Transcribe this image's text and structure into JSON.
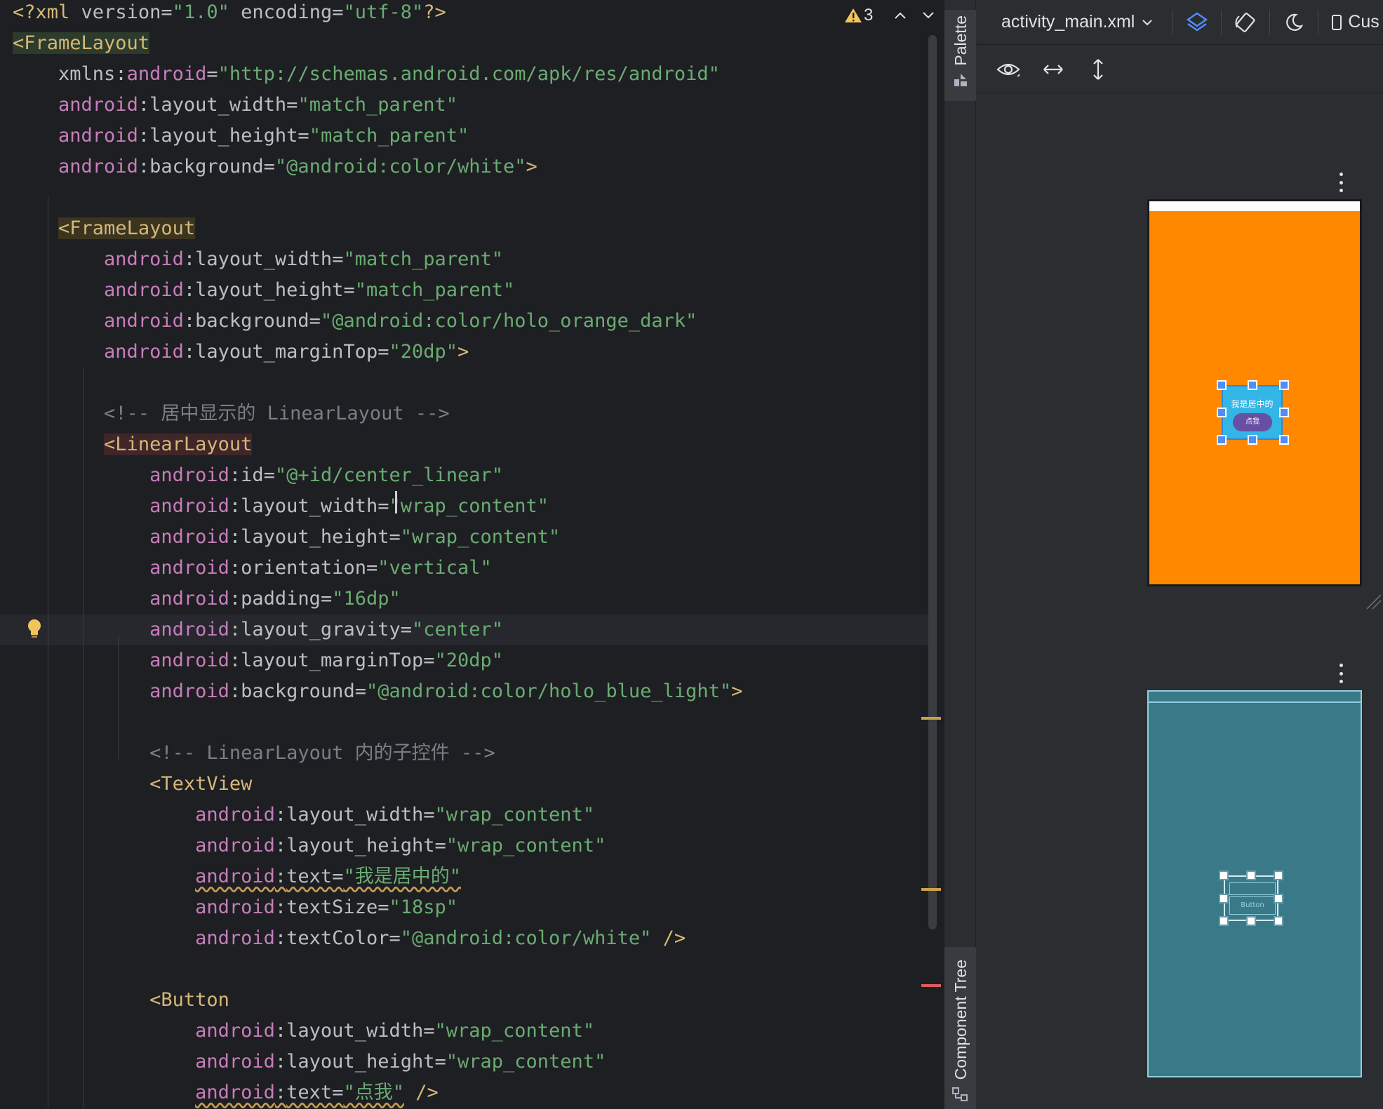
{
  "editor": {
    "lines": [
      [
        {
          "t": "tag",
          "v": "<?xml "
        },
        {
          "t": "attr",
          "v": "version"
        },
        {
          "t": "eq",
          "v": "="
        },
        {
          "t": "str",
          "v": "\"1.0\""
        },
        {
          "t": "plain",
          "v": " "
        },
        {
          "t": "attr",
          "v": "encoding"
        },
        {
          "t": "eq",
          "v": "="
        },
        {
          "t": "str",
          "v": "\"utf-8\""
        },
        {
          "t": "tag",
          "v": "?>"
        }
      ],
      [
        {
          "t": "tag",
          "v": "<FrameLayout",
          "hl": "green"
        }
      ],
      [
        {
          "t": "plain",
          "v": "    "
        },
        {
          "t": "attr",
          "v": "xmlns"
        },
        {
          "t": "eq",
          "v": ":"
        },
        {
          "t": "attrns",
          "v": "android"
        },
        {
          "t": "eq",
          "v": "="
        },
        {
          "t": "str",
          "v": "\"http://schemas.android.com/apk/res/android\""
        }
      ],
      [
        {
          "t": "plain",
          "v": "    "
        },
        {
          "t": "attrns",
          "v": "android"
        },
        {
          "t": "eq",
          "v": ":"
        },
        {
          "t": "attr",
          "v": "layout_width"
        },
        {
          "t": "eq",
          "v": "="
        },
        {
          "t": "str",
          "v": "\"match_parent\""
        }
      ],
      [
        {
          "t": "plain",
          "v": "    "
        },
        {
          "t": "attrns",
          "v": "android"
        },
        {
          "t": "eq",
          "v": ":"
        },
        {
          "t": "attr",
          "v": "layout_height"
        },
        {
          "t": "eq",
          "v": "="
        },
        {
          "t": "str",
          "v": "\"match_parent\""
        }
      ],
      [
        {
          "t": "plain",
          "v": "    "
        },
        {
          "t": "attrns",
          "v": "android"
        },
        {
          "t": "eq",
          "v": ":"
        },
        {
          "t": "attr",
          "v": "background"
        },
        {
          "t": "eq",
          "v": "="
        },
        {
          "t": "str",
          "v": "\"@android:color/white\""
        },
        {
          "t": "tag",
          "v": ">"
        }
      ],
      [],
      [
        {
          "t": "plain",
          "v": "    "
        },
        {
          "t": "tag",
          "v": "<FrameLayout",
          "hl": "olive"
        }
      ],
      [
        {
          "t": "plain",
          "v": "        "
        },
        {
          "t": "attrns",
          "v": "android"
        },
        {
          "t": "eq",
          "v": ":"
        },
        {
          "t": "attr",
          "v": "layout_width"
        },
        {
          "t": "eq",
          "v": "="
        },
        {
          "t": "str",
          "v": "\"match_parent\""
        }
      ],
      [
        {
          "t": "plain",
          "v": "        "
        },
        {
          "t": "attrns",
          "v": "android"
        },
        {
          "t": "eq",
          "v": ":"
        },
        {
          "t": "attr",
          "v": "layout_height"
        },
        {
          "t": "eq",
          "v": "="
        },
        {
          "t": "str",
          "v": "\"match_parent\""
        }
      ],
      [
        {
          "t": "plain",
          "v": "        "
        },
        {
          "t": "attrns",
          "v": "android"
        },
        {
          "t": "eq",
          "v": ":"
        },
        {
          "t": "attr",
          "v": "background"
        },
        {
          "t": "eq",
          "v": "="
        },
        {
          "t": "str",
          "v": "\"@android:color/holo_orange_dark\""
        }
      ],
      [
        {
          "t": "plain",
          "v": "        "
        },
        {
          "t": "attrns",
          "v": "android"
        },
        {
          "t": "eq",
          "v": ":"
        },
        {
          "t": "attr",
          "v": "layout_marginTop"
        },
        {
          "t": "eq",
          "v": "="
        },
        {
          "t": "str",
          "v": "\"20dp\""
        },
        {
          "t": "tag",
          "v": ">"
        }
      ],
      [],
      [
        {
          "t": "plain",
          "v": "        "
        },
        {
          "t": "comment",
          "v": "<!-- 居中显示的 LinearLayout -->"
        }
      ],
      [
        {
          "t": "plain",
          "v": "        "
        },
        {
          "t": "tag",
          "v": "<LinearLayout",
          "hl": "red"
        }
      ],
      [
        {
          "t": "plain",
          "v": "            "
        },
        {
          "t": "attrns",
          "v": "android"
        },
        {
          "t": "eq",
          "v": ":"
        },
        {
          "t": "attr",
          "v": "id"
        },
        {
          "t": "eq",
          "v": "="
        },
        {
          "t": "str",
          "v": "\"@+id/center_linear\""
        }
      ],
      [
        {
          "t": "plain",
          "v": "            "
        },
        {
          "t": "attrns",
          "v": "android"
        },
        {
          "t": "eq",
          "v": ":"
        },
        {
          "t": "attr",
          "v": "layout_width"
        },
        {
          "t": "eq",
          "v": "="
        },
        {
          "t": "str",
          "v": "\"wrap_content\""
        }
      ],
      [
        {
          "t": "plain",
          "v": "            "
        },
        {
          "t": "attrns",
          "v": "android"
        },
        {
          "t": "eq",
          "v": ":"
        },
        {
          "t": "attr",
          "v": "layout_height"
        },
        {
          "t": "eq",
          "v": "="
        },
        {
          "t": "str",
          "v": "\"wrap_content\""
        }
      ],
      [
        {
          "t": "plain",
          "v": "            "
        },
        {
          "t": "attrns",
          "v": "android"
        },
        {
          "t": "eq",
          "v": ":"
        },
        {
          "t": "attr",
          "v": "orientation"
        },
        {
          "t": "eq",
          "v": "="
        },
        {
          "t": "str",
          "v": "\"vertical\""
        }
      ],
      [
        {
          "t": "plain",
          "v": "            "
        },
        {
          "t": "attrns",
          "v": "android"
        },
        {
          "t": "eq",
          "v": ":"
        },
        {
          "t": "attr",
          "v": "padding"
        },
        {
          "t": "eq",
          "v": "="
        },
        {
          "t": "str",
          "v": "\"16dp\""
        }
      ],
      [
        {
          "t": "plain",
          "v": "            "
        },
        {
          "t": "attrns",
          "v": "android"
        },
        {
          "t": "eq",
          "v": ":"
        },
        {
          "t": "attr",
          "v": "layout_gravity"
        },
        {
          "t": "eq",
          "v": "="
        },
        {
          "t": "str",
          "v": "\"center\""
        }
      ],
      [
        {
          "t": "plain",
          "v": "            "
        },
        {
          "t": "attrns",
          "v": "android"
        },
        {
          "t": "eq",
          "v": ":"
        },
        {
          "t": "attr",
          "v": "layout_marginTop"
        },
        {
          "t": "eq",
          "v": "="
        },
        {
          "t": "str",
          "v": "\"20dp\""
        }
      ],
      [
        {
          "t": "plain",
          "v": "            "
        },
        {
          "t": "attrns",
          "v": "android"
        },
        {
          "t": "eq",
          "v": ":"
        },
        {
          "t": "attr",
          "v": "background"
        },
        {
          "t": "eq",
          "v": "="
        },
        {
          "t": "str",
          "v": "\"@android:color/holo_blue_light\""
        },
        {
          "t": "tag",
          "v": ">"
        }
      ],
      [],
      [
        {
          "t": "plain",
          "v": "            "
        },
        {
          "t": "comment",
          "v": "<!-- LinearLayout 内的子控件 -->"
        }
      ],
      [
        {
          "t": "plain",
          "v": "            "
        },
        {
          "t": "tag",
          "v": "<TextView"
        }
      ],
      [
        {
          "t": "plain",
          "v": "                "
        },
        {
          "t": "attrns",
          "v": "android"
        },
        {
          "t": "eq",
          "v": ":"
        },
        {
          "t": "attr",
          "v": "layout_width"
        },
        {
          "t": "eq",
          "v": "="
        },
        {
          "t": "str",
          "v": "\"wrap_content\""
        }
      ],
      [
        {
          "t": "plain",
          "v": "                "
        },
        {
          "t": "attrns",
          "v": "android"
        },
        {
          "t": "eq",
          "v": ":"
        },
        {
          "t": "attr",
          "v": "layout_height"
        },
        {
          "t": "eq",
          "v": "="
        },
        {
          "t": "str",
          "v": "\"wrap_content\""
        }
      ],
      [
        {
          "t": "plain",
          "v": "                "
        },
        {
          "t": "attrns",
          "v": "android",
          "sq": true
        },
        {
          "t": "eq",
          "v": ":",
          "sq": true
        },
        {
          "t": "attr",
          "v": "text",
          "sq": true
        },
        {
          "t": "eq",
          "v": "=",
          "sq": true
        },
        {
          "t": "str",
          "v": "\"我是居中的\"",
          "sq": true
        }
      ],
      [
        {
          "t": "plain",
          "v": "                "
        },
        {
          "t": "attrns",
          "v": "android"
        },
        {
          "t": "eq",
          "v": ":"
        },
        {
          "t": "attr",
          "v": "textSize"
        },
        {
          "t": "eq",
          "v": "="
        },
        {
          "t": "str",
          "v": "\"18sp\""
        }
      ],
      [
        {
          "t": "plain",
          "v": "                "
        },
        {
          "t": "attrns",
          "v": "android"
        },
        {
          "t": "eq",
          "v": ":"
        },
        {
          "t": "attr",
          "v": "textColor"
        },
        {
          "t": "eq",
          "v": "="
        },
        {
          "t": "str",
          "v": "\"@android:color/white\""
        },
        {
          "t": "plain",
          "v": " "
        },
        {
          "t": "tag",
          "v": "/>"
        }
      ],
      [],
      [
        {
          "t": "plain",
          "v": "            "
        },
        {
          "t": "tag",
          "v": "<Button"
        }
      ],
      [
        {
          "t": "plain",
          "v": "                "
        },
        {
          "t": "attrns",
          "v": "android"
        },
        {
          "t": "eq",
          "v": ":"
        },
        {
          "t": "attr",
          "v": "layout_width"
        },
        {
          "t": "eq",
          "v": "="
        },
        {
          "t": "str",
          "v": "\"wrap_content\""
        }
      ],
      [
        {
          "t": "plain",
          "v": "                "
        },
        {
          "t": "attrns",
          "v": "android"
        },
        {
          "t": "eq",
          "v": ":"
        },
        {
          "t": "attr",
          "v": "layout_height"
        },
        {
          "t": "eq",
          "v": "="
        },
        {
          "t": "str",
          "v": "\"wrap_content\""
        }
      ],
      [
        {
          "t": "plain",
          "v": "                "
        },
        {
          "t": "attrns",
          "v": "android",
          "sq": true
        },
        {
          "t": "eq",
          "v": ":",
          "sq": true
        },
        {
          "t": "attr",
          "v": "text",
          "sq": true
        },
        {
          "t": "eq",
          "v": "=",
          "sq": true
        },
        {
          "t": "str",
          "v": "\"点我\"",
          "sq": true
        },
        {
          "t": "plain",
          "v": " "
        },
        {
          "t": "tag",
          "v": "/>"
        }
      ]
    ],
    "current_line": 20,
    "warning_count": "3"
  },
  "side_tabs": {
    "palette": "Palette",
    "component_tree": "Component Tree"
  },
  "design": {
    "file_name": "activity_main.xml",
    "device_label": "Cus",
    "preview": {
      "center_text": "我是居中的",
      "button_text": "点我"
    },
    "blueprint": {
      "button_text": "Button"
    },
    "colors": {
      "orange": "#ff8800",
      "blue_light": "#33b5e5",
      "button_purple": "#6750a4",
      "blueprint_bg": "#3a7a88"
    }
  }
}
